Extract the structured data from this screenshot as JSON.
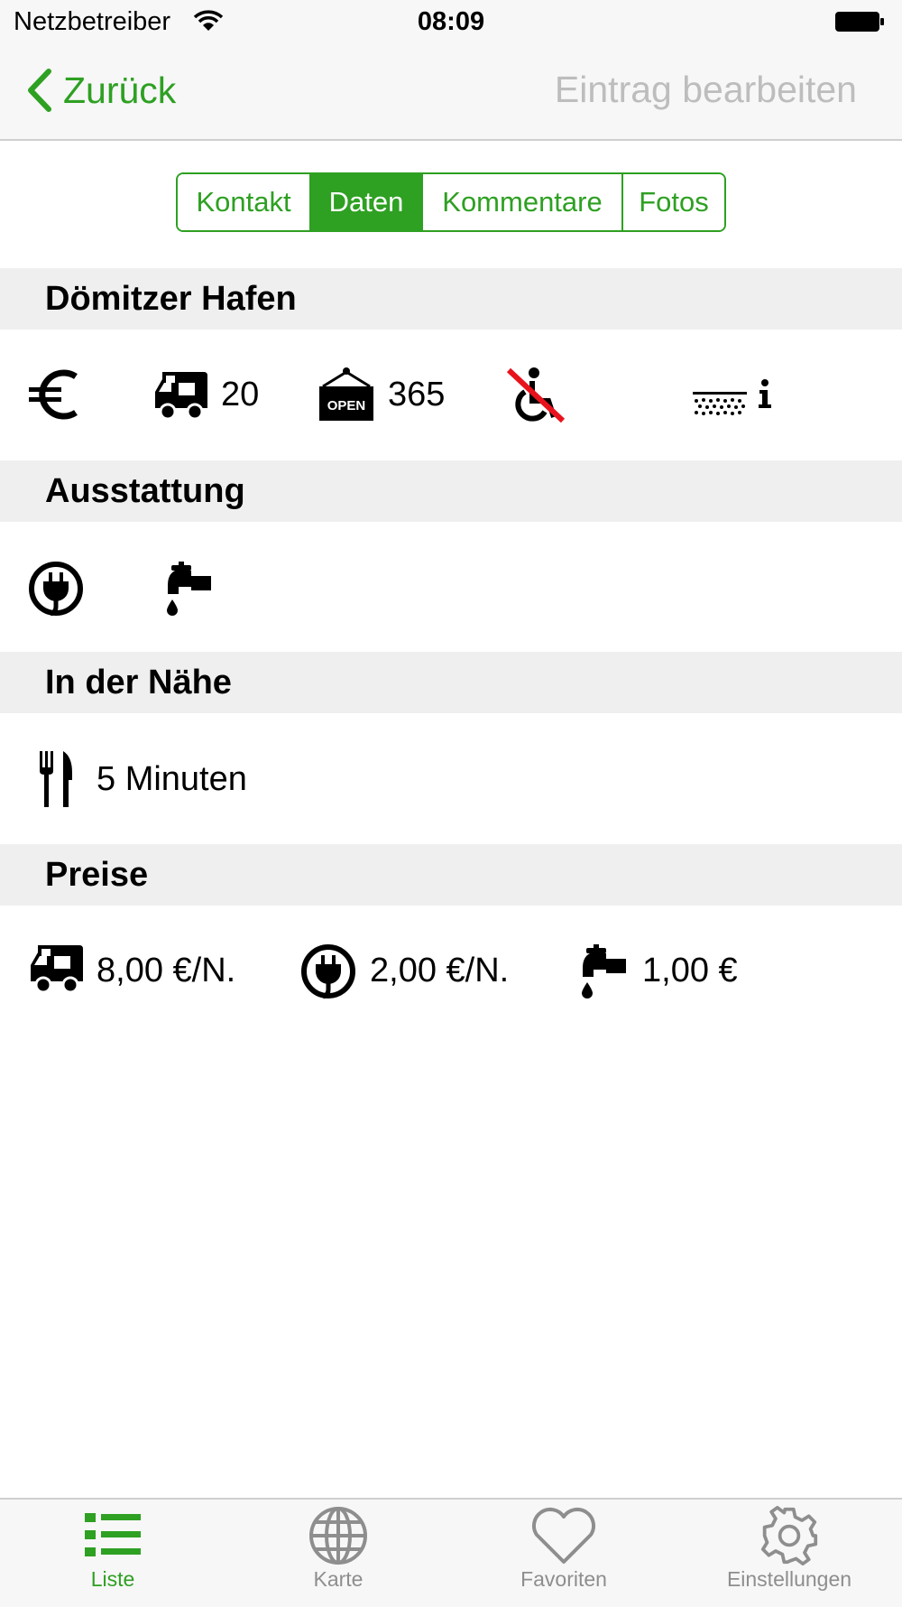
{
  "status_bar": {
    "carrier": "Netzbetreiber",
    "time": "08:09"
  },
  "nav": {
    "back_label": "Zurück",
    "edit_label": "Eintrag bearbeiten"
  },
  "segments": {
    "items": [
      "Kontakt",
      "Daten",
      "Kommentare",
      "Fotos"
    ],
    "selected": "Daten"
  },
  "place": {
    "name": "Dömitzer Hafen",
    "pitches": "20",
    "open_days": "365",
    "icons": [
      "euro-icon",
      "camper-icon",
      "open-sign-icon",
      "wheelchair-crossed-icon",
      "gravel-surface-icon",
      "info-icon"
    ]
  },
  "equipment": {
    "title": "Ausstattung",
    "icons": [
      "power-plug-icon",
      "water-tap-icon"
    ]
  },
  "nearby": {
    "title": "In der Nähe",
    "restaurant": "5 Minuten"
  },
  "prices": {
    "title": "Preise",
    "camper": "8,00 €/N.",
    "power": "2,00 €/N.",
    "water": "1,00 €"
  },
  "tabbar": {
    "items": [
      "Liste",
      "Karte",
      "Favoriten",
      "Einstellungen"
    ],
    "active": "Liste"
  },
  "colors": {
    "accent": "#2ea022",
    "inactive_tab": "#8e8e8e",
    "section_bg": "#efefef",
    "disabled_text": "#bdbdbd"
  }
}
